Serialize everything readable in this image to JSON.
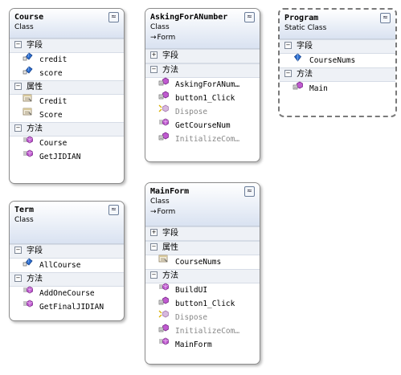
{
  "course": {
    "title": "Course",
    "kind": "Class",
    "fields_label": "字段",
    "fields": [
      "credit",
      "score"
    ],
    "props_label": "属性",
    "props": [
      "Credit",
      "Score"
    ],
    "methods_label": "方法",
    "methods": [
      "Course",
      "GetJIDIAN"
    ]
  },
  "asking": {
    "title": "AskingForANumber",
    "kind": "Class",
    "base": "Form",
    "fields_label": "字段",
    "methods_label": "方法",
    "methods": [
      "AskingForANum…",
      "button1_Click",
      "Dispose",
      "GetCourseNum",
      "InitializeCom…"
    ]
  },
  "program": {
    "title": "Program",
    "kind": "Static Class",
    "fields_label": "字段",
    "fields": [
      "CourseNums"
    ],
    "methods_label": "方法",
    "methods": [
      "Main"
    ]
  },
  "term": {
    "title": "Term",
    "kind": "Class",
    "fields_label": "字段",
    "fields": [
      "AllCourse"
    ],
    "methods_label": "方法",
    "methods": [
      "AddOneCourse",
      "GetFinalJIDIAN"
    ]
  },
  "mainform": {
    "title": "MainForm",
    "kind": "Class",
    "base": "Form",
    "fields_label": "字段",
    "props_label": "属性",
    "props": [
      "CourseNums"
    ],
    "methods_label": "方法",
    "methods": [
      "BuildUI",
      "button1_Click",
      "Dispose",
      "InitializeCom…",
      "MainForm"
    ]
  },
  "glyphs": {
    "collapse": "≈",
    "minus": "−",
    "plus": "+",
    "base_arrow": "→"
  },
  "icons": [
    "field-icon",
    "property-icon",
    "method-icon",
    "protected-method-icon",
    "static-field-icon"
  ],
  "colors": {
    "header": "#d9e2f1",
    "method": "#c05ad0",
    "field": "#2e6fd0",
    "dashed": "#7a7a7a"
  }
}
